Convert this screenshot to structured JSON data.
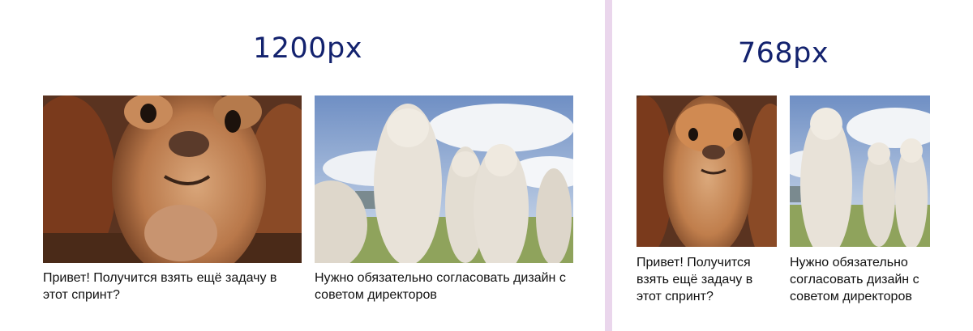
{
  "sections": [
    {
      "heading": "1200px",
      "cards": [
        {
          "image": "close-up brown alpaca face",
          "caption": "Привет! Получится взять ещё задачу в этот спринт?"
        },
        {
          "image": "group of white alpacas under cloudy sky",
          "caption": "Нужно обязательно согласовать дизайн с советом директоров"
        }
      ]
    },
    {
      "heading": "768px",
      "cards": [
        {
          "image": "close-up brown alpaca face",
          "caption": "Привет! Получится взять ещё задачу в этот спринт?"
        },
        {
          "image": "group of white alpacas under cloudy sky",
          "caption": "Нужно обязательно согласовать дизайн с советом директоров"
        }
      ]
    }
  ],
  "colors": {
    "heading": "#13226e",
    "divider": "#ead6ec",
    "caption": "#111111"
  }
}
